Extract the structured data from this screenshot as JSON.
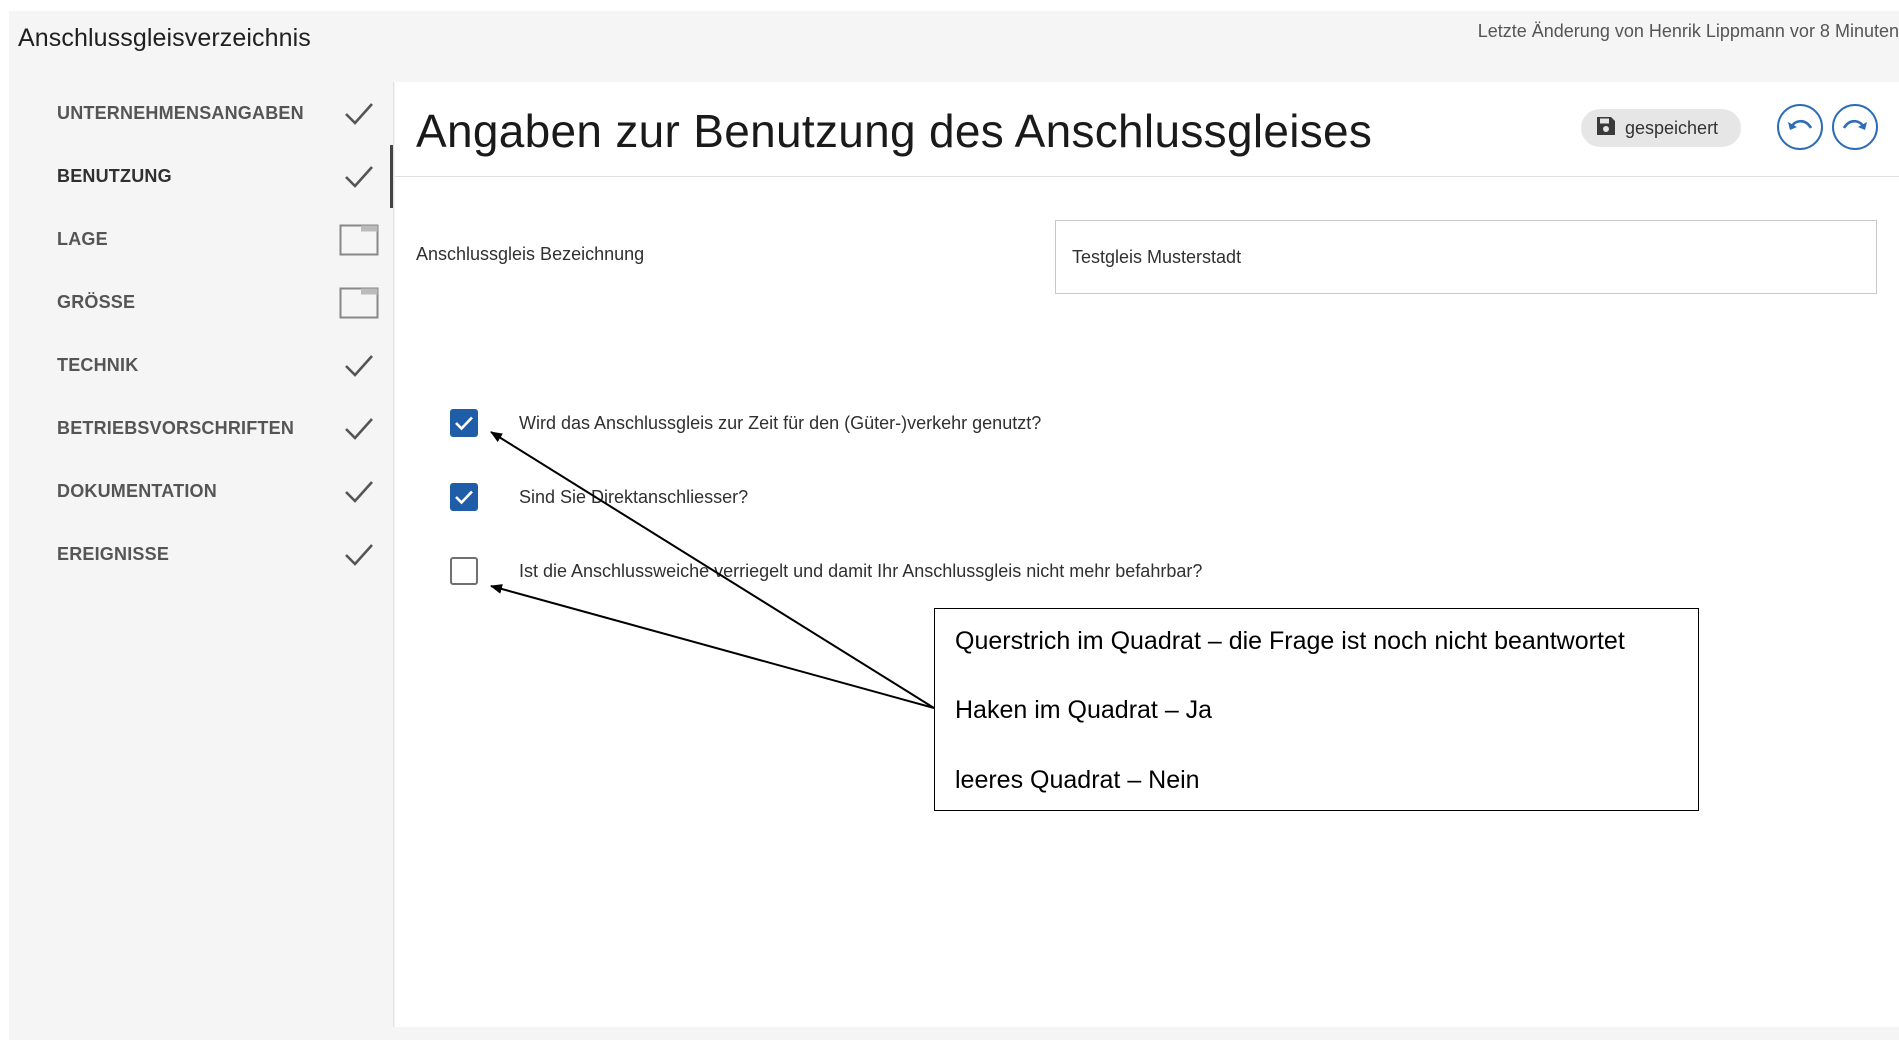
{
  "app": {
    "title": "Anschlussgleisverzeichnis",
    "last_change": "Letzte Änderung von Henrik Lippmann vor 8 Minuten"
  },
  "sidebar": {
    "items": [
      {
        "label": "UNTERNEHMENSANGABEN",
        "status": "check-icon"
      },
      {
        "label": "BENUTZUNG",
        "status": "check-icon",
        "active": true
      },
      {
        "label": "LAGE",
        "status": "empty-box-icon"
      },
      {
        "label": "GRÖSSE",
        "status": "empty-box-icon"
      },
      {
        "label": "TECHNIK",
        "status": "check-icon"
      },
      {
        "label": "BETRIEBSVORSCHRIFTEN",
        "status": "check-icon"
      },
      {
        "label": "DOKUMENTATION",
        "status": "check-icon"
      },
      {
        "label": "EREIGNISSE",
        "status": "check-icon"
      }
    ]
  },
  "main": {
    "page_title": "Angaben zur Benutzung des Anschlussgleises",
    "saved_label": "gespeichert",
    "undo_icon": "undo-icon",
    "redo_icon": "redo-icon",
    "field": {
      "label": "Anschlussgleis Bezeichnung",
      "value": "Testgleis Musterstadt"
    },
    "questions": [
      {
        "text": "Wird das Anschlussgleis zur Zeit für den (Güter-)verkehr genutzt?",
        "checked": true
      },
      {
        "text": "Sind Sie Direktanschliesser?",
        "checked": true
      },
      {
        "text": "Ist die Anschlussweiche verriegelt und damit Ihr Anschlussgleis nicht mehr befahrbar?",
        "checked": false
      }
    ]
  },
  "annotation": {
    "lines": [
      "Querstrich im Quadrat – die Frage ist noch nicht beantwortet",
      "Haken im Quadrat – Ja",
      "leeres Quadrat – Nein"
    ]
  },
  "colors": {
    "accent": "#1f5da8",
    "button_border": "#2d6db5",
    "background": "#f5f5f5"
  }
}
